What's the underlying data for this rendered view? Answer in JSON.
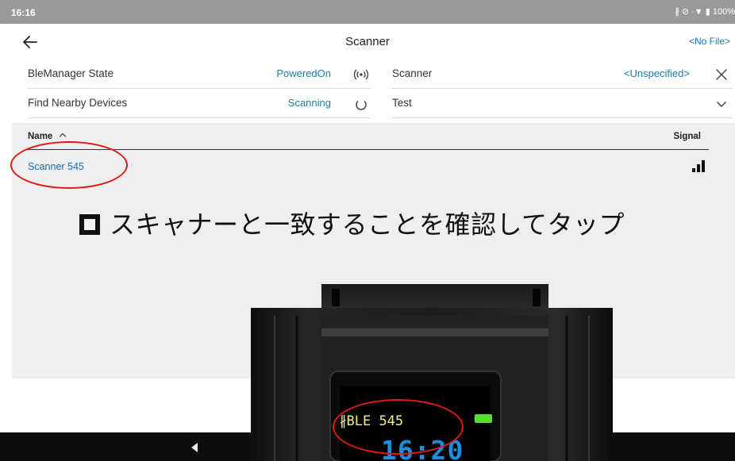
{
  "status_bar": {
    "time": "16:16",
    "icons_text": "∦ ⊘ ·▼ ▮ 100%",
    "battery": "100%"
  },
  "header": {
    "title": "Scanner",
    "file_link": "<No File>",
    "back_icon": "arrow-left-icon"
  },
  "settings": {
    "left": [
      {
        "label": "BleManager State",
        "value": "PoweredOn",
        "icon": "broadcast-icon"
      },
      {
        "label": "Find Nearby Devices",
        "value": "Scanning",
        "icon": "spinner-icon"
      }
    ],
    "right": [
      {
        "label": "Scanner",
        "value": "<Unspecified>",
        "icon": "close-icon"
      },
      {
        "label": "Test",
        "value": "",
        "icon": "chevron-down-icon"
      }
    ]
  },
  "device_list": {
    "columns": {
      "name": "Name",
      "signal": "Signal"
    },
    "sort_icon": "chevron-up-icon",
    "rows": [
      {
        "name": "Scanner 545",
        "signal_icon": "signal-bars-icon"
      }
    ]
  },
  "instruction": {
    "text": "スキャナーと一致することを確認してタップ"
  },
  "device_display": {
    "line1": "∦BLE  545",
    "line2": "16:20"
  },
  "colors": {
    "accent": "#1a73b8",
    "value_blue": "#1f7ea0",
    "highlight_red": "#e01818",
    "status_bar": "#9a9a9a",
    "panel_gray": "#efefef",
    "oled_yellow": "#f2f28c",
    "oled_blue": "#1a8fe0",
    "battery_green": "#55e02a"
  }
}
